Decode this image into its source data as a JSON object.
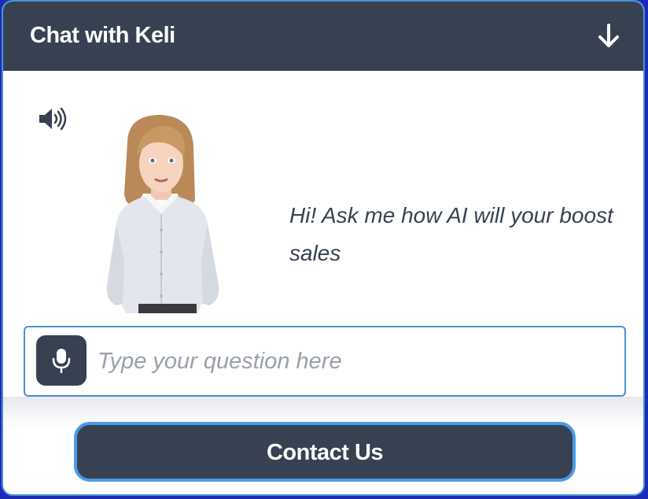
{
  "header": {
    "title": "Chat with Keli",
    "collapse_icon": "arrow-down-icon"
  },
  "speaker": {
    "icon": "speaker-volume-icon"
  },
  "avatar": {
    "name": "Keli"
  },
  "message": {
    "text": "Hi! Ask me how AI will your boost sales"
  },
  "input": {
    "placeholder": "Type your question here",
    "value": "",
    "mic_icon": "microphone-icon"
  },
  "contact": {
    "label": "Contact Us"
  },
  "colors": {
    "header_bg": "#374151",
    "accent_border": "#4a90d9",
    "background": "#ffffff"
  }
}
